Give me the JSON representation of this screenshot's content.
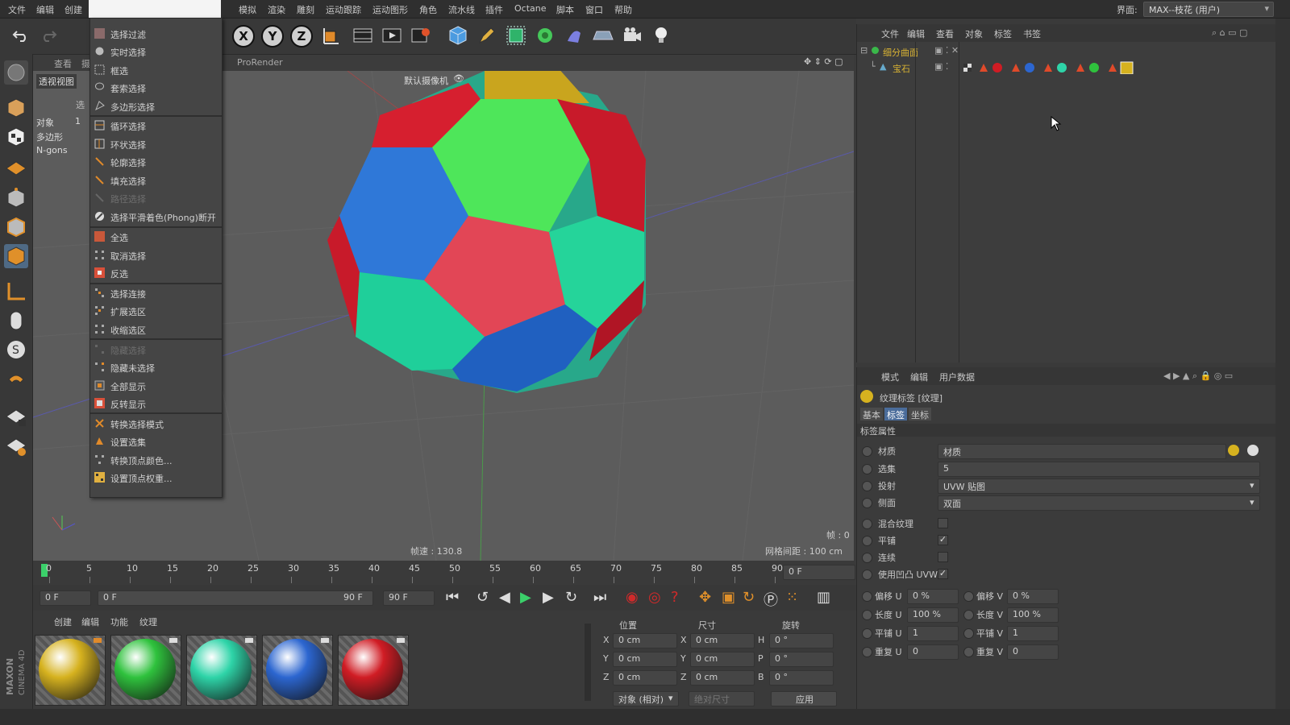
{
  "menubar": {
    "items": [
      "文件",
      "编辑",
      "创建",
      "",
      "模拟",
      "渲染",
      "雕刻",
      "运动跟踪",
      "运动图形",
      "角色",
      "流水线",
      "插件",
      "Octane",
      "脚本",
      "窗口",
      "帮助"
    ],
    "layout_label": "界面:",
    "layout_value": "MAX--枝花 (用户)"
  },
  "viewport": {
    "tabs": [
      "查看",
      "摄",
      "ProRender"
    ],
    "view_name": "透视视图",
    "camera_label": "默认摄像机",
    "stats_header": "选",
    "stats": [
      {
        "label": "对象",
        "value": "1"
      },
      {
        "label": "多边形",
        "value": ""
      },
      {
        "label": "N-gons",
        "value": ""
      }
    ],
    "frame_rate": "帧速 : 130.8",
    "grid_spacing": "网格间距 : 100 cm",
    "frame_counter": "帧 : 0"
  },
  "popup_menu": {
    "items": [
      {
        "label": "选择过滤",
        "enabled": true,
        "icon": "select-filter-icon"
      },
      {
        "label": "实时选择",
        "enabled": true,
        "icon": "live-select-icon"
      },
      {
        "label": "框选",
        "enabled": true,
        "icon": "box-select-icon"
      },
      {
        "label": "套索选择",
        "enabled": true,
        "icon": "lasso-select-icon"
      },
      {
        "label": "多边形选择",
        "enabled": true,
        "icon": "polygon-select-icon"
      },
      {
        "label": "循环选择",
        "enabled": true,
        "icon": "loop-select-icon"
      },
      {
        "label": "环状选择",
        "enabled": true,
        "icon": "ring-select-icon"
      },
      {
        "label": "轮廓选择",
        "enabled": true,
        "icon": "outline-select-icon"
      },
      {
        "label": "填充选择",
        "enabled": true,
        "icon": "fill-select-icon"
      },
      {
        "label": "路径选择",
        "enabled": false,
        "icon": "path-select-icon"
      },
      {
        "label": "选择平滑着色(Phong)断开",
        "enabled": true,
        "icon": "phong-break-icon"
      },
      {
        "label": "全选",
        "enabled": true,
        "icon": "select-all-icon"
      },
      {
        "label": "取消选择",
        "enabled": true,
        "icon": "deselect-icon"
      },
      {
        "label": "反选",
        "enabled": true,
        "icon": "invert-select-icon"
      },
      {
        "label": "选择连接",
        "enabled": true,
        "icon": "select-connected-icon"
      },
      {
        "label": "扩展选区",
        "enabled": true,
        "icon": "grow-selection-icon"
      },
      {
        "label": "收缩选区",
        "enabled": true,
        "icon": "shrink-selection-icon"
      },
      {
        "label": "隐藏选择",
        "enabled": false,
        "icon": "hide-selected-icon"
      },
      {
        "label": "隐藏未选择",
        "enabled": true,
        "icon": "hide-unselected-icon"
      },
      {
        "label": "全部显示",
        "enabled": true,
        "icon": "unhide-all-icon"
      },
      {
        "label": "反转显示",
        "enabled": true,
        "icon": "invert-visibility-icon"
      },
      {
        "label": "转换选择模式",
        "enabled": true,
        "icon": "convert-selection-icon"
      },
      {
        "label": "设置选集",
        "enabled": true,
        "icon": "set-selection-icon"
      },
      {
        "label": "转换顶点颜色...",
        "enabled": true,
        "icon": "convert-vertex-color-icon"
      },
      {
        "label": "设置顶点权重...",
        "enabled": true,
        "icon": "set-vertex-weight-icon"
      }
    ]
  },
  "object_manager": {
    "menu": [
      "文件",
      "编辑",
      "查看",
      "对象",
      "标签",
      "书签"
    ],
    "objects": [
      {
        "name": "细分曲面",
        "color": "#d8b233"
      },
      {
        "name": "宝石",
        "color": "#d8b233"
      }
    ]
  },
  "attribute_manager": {
    "menu": [
      "模式",
      "编辑",
      "用户数据"
    ],
    "title": "纹理标签 [纹理]",
    "tabs": [
      "基本",
      "标签",
      "坐标"
    ],
    "section": "标签属性",
    "material_label": "材质",
    "material_value": "材质",
    "selection_label": "选集",
    "selection_value": "5",
    "projection_label": "投射",
    "projection_value": "UVW 贴图",
    "side_label": "侧面",
    "side_value": "双面",
    "checks": [
      {
        "label": "混合纹理",
        "checked": false
      },
      {
        "label": "平铺",
        "checked": true
      },
      {
        "label": "连续",
        "checked": false
      },
      {
        "label": "使用凹凸 UVW",
        "checked": true
      }
    ],
    "offset_u_label": "偏移 U",
    "offset_u": "0 %",
    "offset_v_label": "偏移 V",
    "offset_v": "0 %",
    "length_u_label": "长度 U",
    "length_u": "100 %",
    "length_v_label": "长度 V",
    "length_v": "100 %",
    "tile_u_label": "平铺 U",
    "tile_u": "1",
    "tile_v_label": "平铺 V",
    "tile_v": "1",
    "repeat_u_label": "重复 U",
    "repeat_u": "0",
    "repeat_v_label": "重复 V",
    "repeat_v": "0"
  },
  "timeline": {
    "ticks": [
      "0",
      "5",
      "10",
      "15",
      "20",
      "25",
      "30",
      "35",
      "40",
      "45",
      "50",
      "55",
      "60",
      "65",
      "70",
      "75",
      "80",
      "85",
      "90"
    ],
    "current_frame": "0 F",
    "start": "0 F",
    "range_start": "0 F",
    "range_end": "90 F",
    "end": "90 F"
  },
  "material_manager": {
    "menu": [
      "创建",
      "编辑",
      "功能",
      "纹理"
    ],
    "materials": [
      {
        "name": "gold",
        "color": "#d6b21f"
      },
      {
        "name": "green",
        "color": "#2fc23d"
      },
      {
        "name": "teal",
        "color": "#2ed4a8"
      },
      {
        "name": "blue",
        "color": "#2c66d0"
      },
      {
        "name": "red",
        "color": "#d01c24"
      }
    ]
  },
  "coordinates": {
    "headers": [
      "位置",
      "尺寸",
      "旋转"
    ],
    "rows": [
      {
        "axis": "X",
        "pos": "0 cm",
        "size_axis": "X",
        "size": "0 cm",
        "rot_axis": "H",
        "rot": "0 °"
      },
      {
        "axis": "Y",
        "pos": "0 cm",
        "size_axis": "Y",
        "size": "0 cm",
        "rot_axis": "P",
        "rot": "0 °"
      },
      {
        "axis": "Z",
        "pos": "0 cm",
        "size_axis": "Z",
        "size": "0 cm",
        "rot_axis": "B",
        "rot": "0 °"
      }
    ],
    "mode": "对象 (相对)",
    "size_mode": "绝对尺寸",
    "apply": "应用"
  },
  "branding": {
    "logo_text": "MAXON CINEMA 4D"
  },
  "colors": {
    "accent": "#2ea0ff",
    "bg": "#3a3a3a",
    "viewport": "#5a5a5a"
  }
}
